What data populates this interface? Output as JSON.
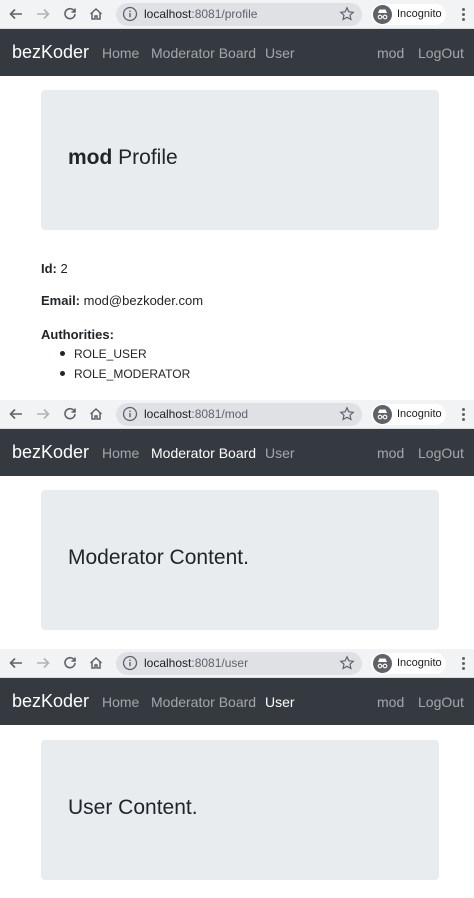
{
  "browser": {
    "incognito_label": "Incognito"
  },
  "app": {
    "brand": "bezKoder",
    "nav": {
      "home": "Home",
      "moderator_board": "Moderator Board",
      "user": "User",
      "username": "mod",
      "logout": "LogOut"
    }
  },
  "screens": [
    {
      "url_host": "localhost",
      "url_path": ":8081/profile",
      "active_nav": "none",
      "heading_bold": "mod",
      "heading_rest": " Profile",
      "profile": {
        "id_label": "Id:",
        "id_value": " 2",
        "email_label": "Email:",
        "email_value": " mod@bezkoder.com",
        "authorities_label": "Authorities:",
        "authorities": [
          "ROLE_USER",
          "ROLE_MODERATOR"
        ]
      }
    },
    {
      "url_host": "localhost",
      "url_path": ":8081/mod",
      "active_nav": "moderator_board",
      "heading": "Moderator Content."
    },
    {
      "url_host": "localhost",
      "url_path": ":8081/user",
      "active_nav": "user",
      "heading": "User Content."
    }
  ]
}
